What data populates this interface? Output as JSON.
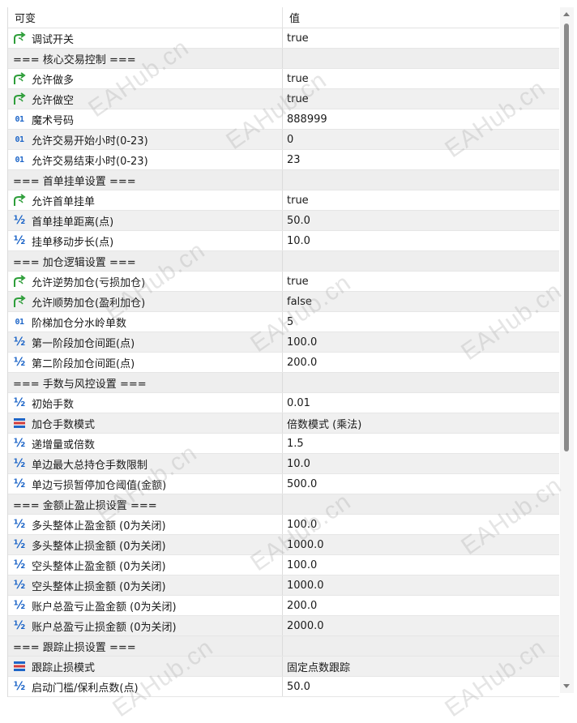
{
  "header": {
    "col_name": "可变",
    "col_value": "值"
  },
  "rows": [
    {
      "icon": "bool",
      "name": "调试开关",
      "value": "true"
    },
    {
      "icon": "section",
      "name": "=== 核心交易控制 ===",
      "value": ""
    },
    {
      "icon": "bool",
      "name": "允许做多",
      "value": "true"
    },
    {
      "icon": "bool",
      "name": "允许做空",
      "value": "true"
    },
    {
      "icon": "int",
      "name": "魔术号码",
      "value": "888999"
    },
    {
      "icon": "int",
      "name": "允许交易开始小时(0-23)",
      "value": "0"
    },
    {
      "icon": "int",
      "name": "允许交易结束小时(0-23)",
      "value": "23"
    },
    {
      "icon": "section",
      "name": "=== 首单挂单设置 ===",
      "value": ""
    },
    {
      "icon": "bool",
      "name": "允许首单挂单",
      "value": "true"
    },
    {
      "icon": "double",
      "name": "首单挂单距离(点)",
      "value": "50.0"
    },
    {
      "icon": "double",
      "name": "挂单移动步长(点)",
      "value": "10.0"
    },
    {
      "icon": "section",
      "name": "=== 加仓逻辑设置 ===",
      "value": ""
    },
    {
      "icon": "bool",
      "name": "允许逆势加仓(亏损加仓)",
      "value": "true"
    },
    {
      "icon": "bool",
      "name": "允许顺势加仓(盈利加仓)",
      "value": "false"
    },
    {
      "icon": "int",
      "name": "阶梯加仓分水岭单数",
      "value": "5"
    },
    {
      "icon": "double",
      "name": "第一阶段加仓间距(点)",
      "value": "100.0"
    },
    {
      "icon": "double",
      "name": "第二阶段加仓间距(点)",
      "value": "200.0"
    },
    {
      "icon": "section",
      "name": "=== 手数与风控设置 ===",
      "value": ""
    },
    {
      "icon": "double",
      "name": "初始手数",
      "value": "0.01"
    },
    {
      "icon": "enum",
      "name": "加仓手数模式",
      "value": "倍数模式 (乘法)"
    },
    {
      "icon": "double",
      "name": "递增量或倍数",
      "value": "1.5"
    },
    {
      "icon": "double",
      "name": "单边最大总持仓手数限制",
      "value": "10.0"
    },
    {
      "icon": "double",
      "name": "单边亏损暂停加仓阈值(金额)",
      "value": "500.0"
    },
    {
      "icon": "section",
      "name": "=== 金额止盈止损设置 ===",
      "value": ""
    },
    {
      "icon": "double",
      "name": "多头整体止盈金额 (0为关闭)",
      "value": "100.0"
    },
    {
      "icon": "double",
      "name": "多头整体止损金额 (0为关闭)",
      "value": "1000.0"
    },
    {
      "icon": "double",
      "name": "空头整体止盈金额 (0为关闭)",
      "value": "100.0"
    },
    {
      "icon": "double",
      "name": "空头整体止损金额 (0为关闭)",
      "value": "1000.0"
    },
    {
      "icon": "double",
      "name": "账户总盈亏止盈金额 (0为关闭)",
      "value": "200.0"
    },
    {
      "icon": "double",
      "name": "账户总盈亏止损金额 (0为关闭)",
      "value": "2000.0"
    },
    {
      "icon": "section",
      "name": "=== 跟踪止损设置 ===",
      "value": ""
    },
    {
      "icon": "enum",
      "name": "跟踪止损模式",
      "value": "固定点数跟踪"
    },
    {
      "icon": "double",
      "name": "启动门槛/保利点数(点)",
      "value": "50.0"
    }
  ],
  "icons": {
    "bool": "bool-arrow-icon",
    "int": "int-01-icon",
    "double": "double-half-icon",
    "enum": "enum-list-icon"
  },
  "colors": {
    "icon_blue": "#1e66c8",
    "icon_green": "#2e9e3a",
    "icon_red": "#d23b3b",
    "row_alt": "#f0f0f0"
  },
  "watermark": "EAHub.cn"
}
